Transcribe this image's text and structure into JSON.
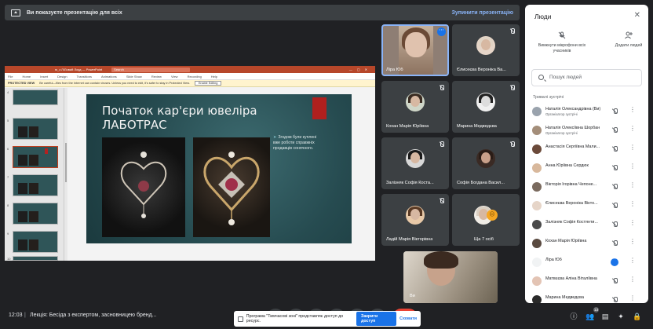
{
  "banner": {
    "message": "Ви показуєте презентацію для всіх",
    "stop_label": "Зупинити презентацію"
  },
  "ppt": {
    "title": "ю_з ЛІЛовий Лоуд — PowerPoint",
    "search": "Search",
    "menu": [
      "File",
      "Home",
      "Insert",
      "Design",
      "Transitions",
      "Animations",
      "Slide Show",
      "Review",
      "View",
      "Recording",
      "Help"
    ],
    "protected_label": "PROTECTED VIEW",
    "protected_text": "Be careful—files from the Internet can contain viruses. Unless you need to edit, it's safer to stay in Protected View.",
    "enable_label": "Enable Editing",
    "thumb_numbers": [
      "4",
      "5",
      "6",
      "7",
      "8",
      "9",
      "10"
    ],
    "slide_title_1": "Початок кар'єри ювеліра",
    "slide_title_2": "ЛАБОТРАС",
    "slide_bullet": "Згодом були куплені вже роботи справжніх продавців сонячного."
  },
  "tiles": [
    {
      "name": "Ліра Юб"
    },
    {
      "name": "Єлисеєва Вероніка Ва..."
    },
    {
      "name": "Кохан Марія Юріївна"
    },
    {
      "name": "Марина Медведєва"
    },
    {
      "name": "Залізняк Софія Коста..."
    },
    {
      "name": "Софія Богдана Васил..."
    },
    {
      "name": "Ладій Марія Вікторівна"
    },
    {
      "name": "Ща 7 осіб"
    }
  ],
  "self_name": "Ви",
  "panel": {
    "title": "Люди",
    "mute_all": "Вимкнути мікрофони всіх учасників",
    "add_people": "Додати людей",
    "search_placeholder": "Пошук людей",
    "section": "Тривалі зустрічі",
    "people": [
      {
        "name": "Наталія Олександрівна (Ви)",
        "sub": "Організатор зустрічі"
      },
      {
        "name": "Наталія Олексіївна Шорбан",
        "sub": "Організатор зустрічі"
      },
      {
        "name": "Анастасія Сергіївна Мали...",
        "sub": ""
      },
      {
        "name": "Анна Юріївна Сердюк",
        "sub": ""
      },
      {
        "name": "Вікторія Ігорівна Чепоне...",
        "sub": ""
      },
      {
        "name": "Єлисеєва Вероніка Вікто...",
        "sub": ""
      },
      {
        "name": "Залізняк Софія Костянти...",
        "sub": ""
      },
      {
        "name": "Кохан Марія Юріївна",
        "sub": ""
      },
      {
        "name": "Ліра Юб",
        "sub": ""
      },
      {
        "name": "Матвєєва Аліна Віталіївна",
        "sub": ""
      },
      {
        "name": "Марина Медведєва",
        "sub": ""
      }
    ]
  },
  "bottom": {
    "time": "12:03",
    "separator": "|",
    "meeting_name": "Лекція: Бесіда з експертом, засновницею бренд...",
    "notice_text": "Програма \"Тимчасові зоні\" представляє доступ до ресурс.",
    "share_label": "Закрити доступ",
    "hide_label": "Сховати",
    "people_count": "13"
  }
}
